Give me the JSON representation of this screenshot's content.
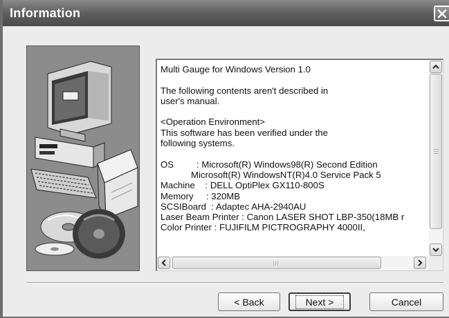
{
  "window": {
    "title": "Information",
    "close_icon": "close-x-icon"
  },
  "illustration": {
    "icon": "computer-with-disks-illustration"
  },
  "text_box": {
    "lines": [
      "Multi Gauge for Windows Version 1.0",
      "",
      "The following contents aren't described in",
      "user's manual.",
      "",
      "<Operation Environment>",
      "This software has been verified under the",
      "following systems.",
      "",
      "OS         : Microsoft(R) Windows98(R) Second Edition",
      "            Microsoft(R) WindowsNT(R)4.0 Service Pack 5",
      "Machine    : DELL OptiPlex GX110-800S",
      "Memory     : 320MB",
      "SCSIBoard  : Adaptec AHA-2940AU",
      "Laser Beam Printer : Canon LASER SHOT LBP-350(18MB r",
      "Color Printer : FUJIFILM PICTROGRAPHY 4000II,"
    ]
  },
  "buttons": {
    "back": "< Back",
    "next": "Next >",
    "cancel": "Cancel"
  }
}
